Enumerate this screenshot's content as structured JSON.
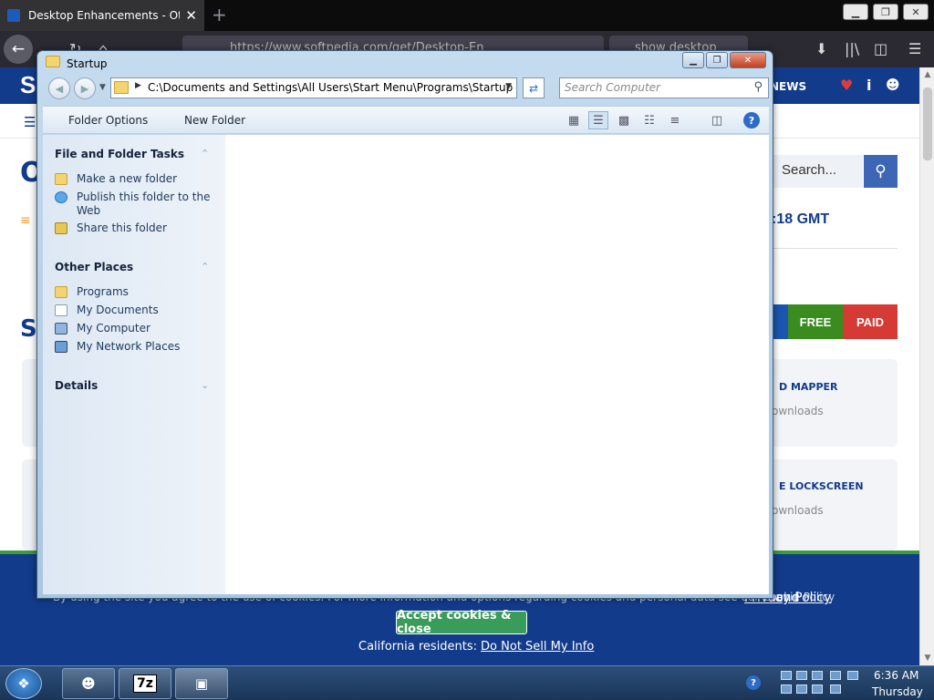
{
  "browser": {
    "tab_title": "Desktop Enhancements - Other",
    "tab_close": "✕",
    "new_tab": "+",
    "url": "https://www.softpedia.com/get/Desktop-En",
    "search_query": "show desktop",
    "window_controls": [
      "▁",
      "❐",
      "✕"
    ]
  },
  "page": {
    "logo": "S",
    "news": "NEWS",
    "search_placeholder": "Search...",
    "gmt_text": ":18 GMT",
    "big_letter": "O",
    "section_letters": "SO",
    "free": "FREE",
    "paid": "PAID",
    "cards": [
      {
        "title": "D MAPPER",
        "sub": "ownloads"
      },
      {
        "title": "E LOCKSCREEN",
        "sub": "ownloads"
      }
    ],
    "cookie_text": "By using the site you agree to the use of cookies. For more information and options regarding cookies and personal data see our Cookie Policy",
    "and": "and",
    "privacy": "Privacy Policy",
    "accept": "Accept cookies & close",
    "california": "California residents:",
    "do_not_sell": "Do Not Sell My Info"
  },
  "explorer": {
    "title": "Startup",
    "address": "C:\\Documents and Settings\\All Users\\Start Menu\\Programs\\Startup",
    "search_placeholder": "Search Computer",
    "toolbar": {
      "folder_options": "Folder Options",
      "new_folder": "New Folder"
    },
    "sections": {
      "tasks": {
        "title": "File and Folder Tasks",
        "items": [
          {
            "label": "Make a new folder",
            "icon": "folder-icon"
          },
          {
            "label": "Publish this folder to the Web",
            "icon": "globe-icon"
          },
          {
            "label": "Share this folder",
            "icon": "share-icon"
          }
        ]
      },
      "places": {
        "title": "Other Places",
        "items": [
          {
            "label": "Programs",
            "icon": "folder-icon"
          },
          {
            "label": "My Documents",
            "icon": "documents-icon"
          },
          {
            "label": "My Computer",
            "icon": "computer-icon"
          },
          {
            "label": "My Network Places",
            "icon": "network-icon"
          }
        ]
      },
      "details": {
        "title": "Details"
      }
    }
  },
  "taskbar": {
    "buttons": [
      "raccoon-app",
      "7z",
      "explorer"
    ],
    "seven_zip_label": "7z",
    "time": "6:36 AM",
    "day": "Thursday"
  }
}
